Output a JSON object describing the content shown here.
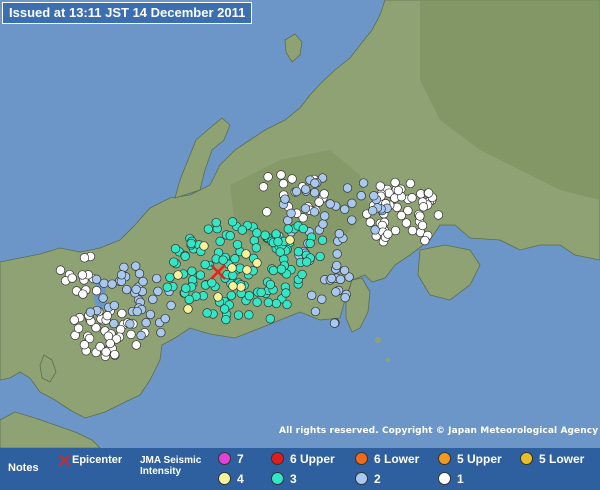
{
  "header": {
    "issued": "Issued at 13:11 JST  14 December 2011"
  },
  "copyright": "All rights reserved. Copyright © Japan Meteorological Agency",
  "legend": {
    "notes_label": "Notes",
    "epicenter_label": "Epicenter",
    "jma_label": "JMA Seismic Intensity",
    "intensities": [
      {
        "label": "7",
        "color": "#e33fd9"
      },
      {
        "label": "6 Upper",
        "color": "#e01c1c"
      },
      {
        "label": "6 Lower",
        "color": "#ef6a1a"
      },
      {
        "label": "5 Upper",
        "color": "#f29a1e"
      },
      {
        "label": "5 Lower",
        "color": "#e8c024"
      },
      {
        "label": "4",
        "color": "#f5f29a"
      },
      {
        "label": "3",
        "color": "#33e6c4"
      },
      {
        "label": "2",
        "color": "#a8c8ee"
      },
      {
        "label": "1",
        "color": "#ffffff"
      }
    ]
  },
  "map_style": {
    "sea": "#6b96c7",
    "land": "#8ea274",
    "land_dark": "#778b62",
    "epicenter_color": "#e8201c"
  }
}
